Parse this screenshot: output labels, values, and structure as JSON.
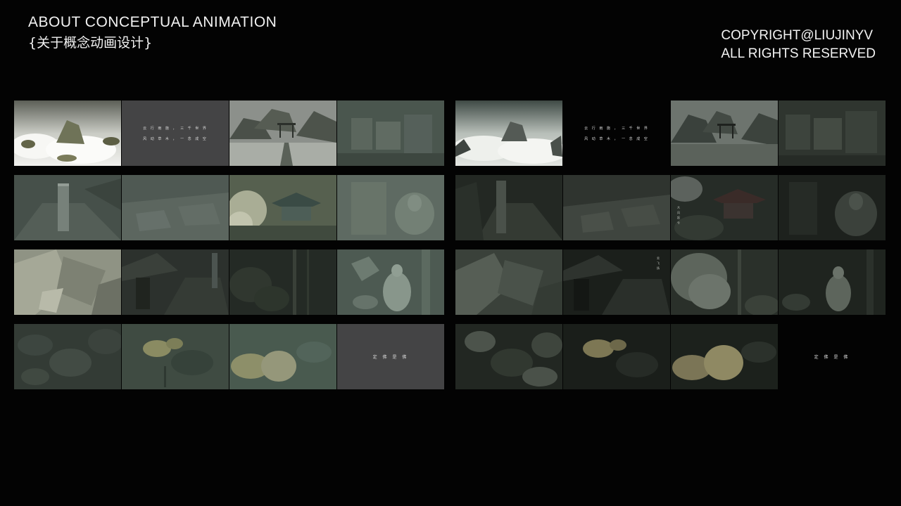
{
  "header": {
    "title": "ABOUT CONCEPTUAL ANIMATION",
    "subtitle": "{关于概念动画设计}"
  },
  "copyright": {
    "line1": "COPYRIGHT@LIUJINYV",
    "line2": "ALL RIGHTS RESERVED"
  },
  "left_board": {
    "card_intro": {
      "line1": "云 行 雨 施 ， 三 千 世 界",
      "line2": "风 动 草 木 ， 一 念 成 空"
    },
    "card_end": {
      "line1": "定 佛 是 佛"
    }
  },
  "right_board": {
    "card_intro": {
      "line1": "云 行 雨 施 ， 三 千 世 界",
      "line2": "风 动 草 木 ， 一 念 成 空"
    },
    "card_vertical": {
      "line1": "大 风 起 兮",
      "line2": "云 飞 扬"
    },
    "card_end": {
      "line1": "定 佛 是 佛"
    }
  }
}
